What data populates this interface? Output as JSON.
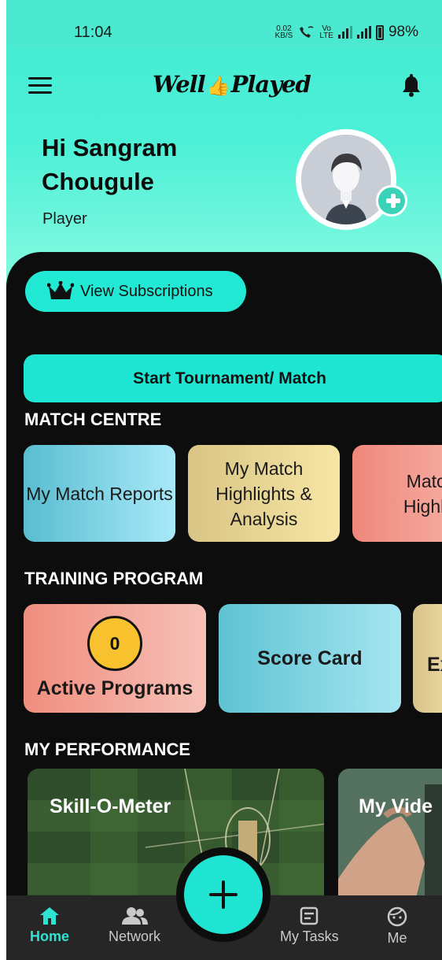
{
  "status_bar": {
    "time": "11:04",
    "speed_value": "0.02",
    "speed_unit": "KB/S",
    "volte_top": "Vo",
    "volte_bottom": "LTE",
    "battery": "98%"
  },
  "app_bar": {
    "logo_left": "Well",
    "logo_right": "Played",
    "logo_icon": "thumbs-up-icon"
  },
  "profile": {
    "greeting": "Hi Sangram Chougule",
    "role": "Player"
  },
  "subscriptions_button": {
    "label": "View Subscriptions",
    "icon": "crown-icon"
  },
  "start_button": {
    "label": "Start Tournament/ Match"
  },
  "match_centre": {
    "title": "MATCH CENTRE",
    "cards": [
      "My Match Reports",
      "My Match Highlights & Analysis",
      "Match Highlig"
    ]
  },
  "training_program": {
    "title": "TRAINING PROGRAM",
    "active_count": "0",
    "active_label": "Active Programs",
    "score_card": "Score Card",
    "third_card": "Ex"
  },
  "my_performance": {
    "title": "MY PERFORMANCE",
    "cards": [
      "Skill-O-Meter",
      "My Vide"
    ]
  },
  "bottom_nav": {
    "items": [
      {
        "label": "Home",
        "icon": "home-icon",
        "active": true
      },
      {
        "label": "Network",
        "icon": "people-icon",
        "active": false
      },
      {
        "label": "My Tasks",
        "icon": "tasks-icon",
        "active": false
      },
      {
        "label": "Me",
        "icon": "face-icon",
        "active": false
      }
    ],
    "fab_icon": "plus-icon"
  },
  "colors": {
    "accent": "#20e4d2",
    "panel": "#0d0d0d",
    "nav_active": "#2fe3d3"
  }
}
